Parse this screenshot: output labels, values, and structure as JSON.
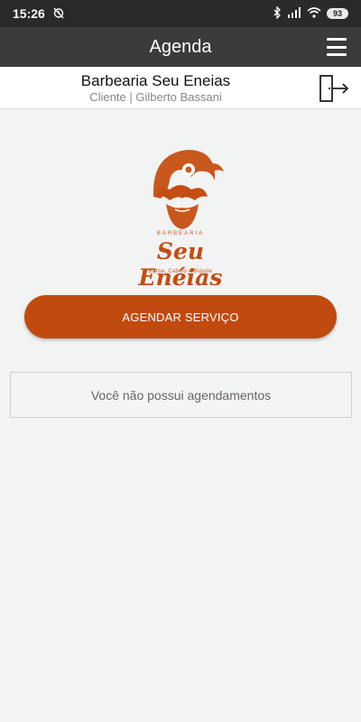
{
  "status_bar": {
    "time": "15:26",
    "battery": "93",
    "icons": [
      "alarm-off-icon",
      "bluetooth-icon",
      "signal-icon",
      "wifi-icon",
      "battery-icon"
    ]
  },
  "app_bar": {
    "title": "Agenda",
    "menu_icon": "hamburger-menu-icon"
  },
  "info_bar": {
    "shop_name": "Barbearia Seu Eneias",
    "client_line": "Cliente | Gilberto Bassani",
    "logout_icon": "logout-door-icon"
  },
  "logo": {
    "top_text": "BARBEARIA",
    "name": "Seu Enéias",
    "tagline": "Barba, Cabelo e Bigode"
  },
  "actions": {
    "schedule_button": "AGENDAR SERVIÇO"
  },
  "appointments": {
    "empty_message": "Você não possui agendamentos"
  },
  "colors": {
    "accent": "#c14a0e",
    "app_bar": "#3b3b3b",
    "status_bar": "#2a2a2a",
    "background": "#f2f3f3"
  }
}
